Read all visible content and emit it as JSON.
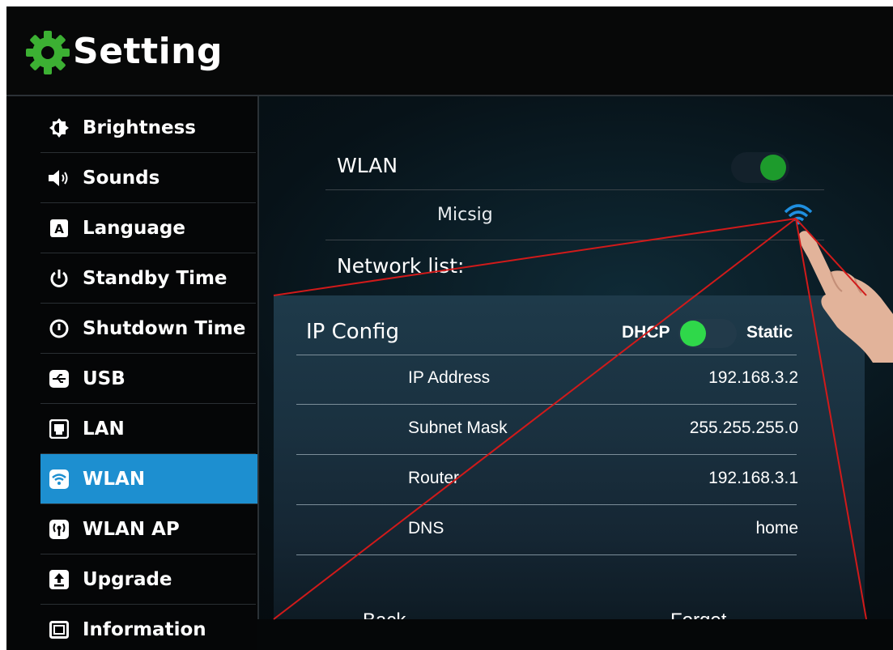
{
  "header": {
    "title": "Setting",
    "icon": "gear-icon",
    "icon_color": "#3cb033"
  },
  "sidebar": {
    "items": [
      {
        "label": "Brightness",
        "icon": "brightness-icon"
      },
      {
        "label": "Sounds",
        "icon": "speaker-icon"
      },
      {
        "label": "Language",
        "icon": "language-icon"
      },
      {
        "label": "Standby Time",
        "icon": "power-icon"
      },
      {
        "label": "Shutdown Time",
        "icon": "shutdown-icon"
      },
      {
        "label": "USB",
        "icon": "usb-icon"
      },
      {
        "label": "LAN",
        "icon": "lan-icon"
      },
      {
        "label": "WLAN",
        "icon": "wifi-icon",
        "selected": true
      },
      {
        "label": "WLAN AP",
        "icon": "hotspot-icon"
      },
      {
        "label": "Upgrade",
        "icon": "upgrade-icon"
      },
      {
        "label": "Information",
        "icon": "information-icon"
      }
    ],
    "selected_color": "#1d8fd0"
  },
  "wlan": {
    "label": "WLAN",
    "enabled": true,
    "network_name": "Micsig",
    "network_list_label": "Network list:"
  },
  "ip_config": {
    "title": "IP Config",
    "dhcp_label": "DHCP",
    "static_label": "Static",
    "mode": "DHCP",
    "fields": [
      {
        "key": "IP Address",
        "value": "192.168.3.2"
      },
      {
        "key": "Subnet Mask",
        "value": "255.255.255.0"
      },
      {
        "key": "Router",
        "value": "192.168.3.1"
      },
      {
        "key": "DNS",
        "value": "home"
      }
    ],
    "back_label": "Back",
    "forget_label": "Forget"
  },
  "colors": {
    "toggle_on": "#1d9b2c",
    "dhcp_knob": "#2fd84a",
    "callout_lines": "#d11a1a"
  }
}
